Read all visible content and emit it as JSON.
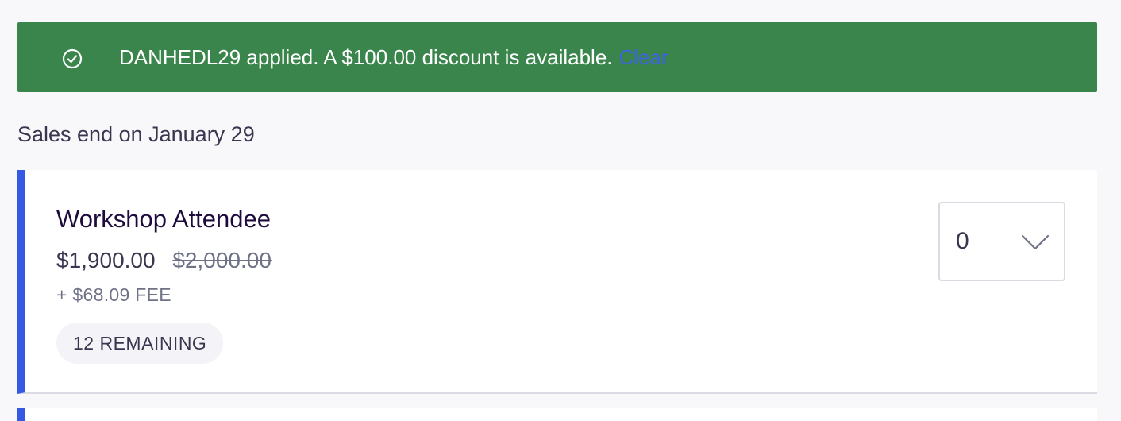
{
  "banner": {
    "message": "DANHEDL29 applied. A $100.00 discount is available.",
    "clear_label": "Clear",
    "icon": "check-circle-icon",
    "background_color": "#3a854c"
  },
  "sales_end": "Sales end on January 29",
  "ticket": {
    "name": "Workshop Attendee",
    "price_current": "$1,900.00",
    "price_original": "$2,000.00",
    "fee": "+ $68.09 FEE",
    "remaining": "12 REMAINING",
    "quantity": "0",
    "accent_color": "#3659e3"
  }
}
